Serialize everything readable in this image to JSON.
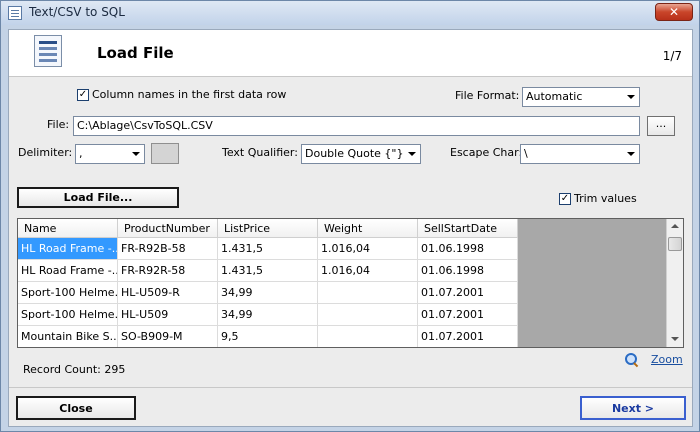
{
  "window": {
    "title": "Text/CSV to SQL",
    "close_glyph": "✕"
  },
  "header": {
    "title": "Load File",
    "step": "1/7"
  },
  "options": {
    "column_names_label": "Column names in the first data row",
    "column_names_checked": "✓",
    "file_format_label": "File Format:",
    "file_format_value": "Automatic",
    "file_label": "File:",
    "file_value": "C:\\Ablage\\CsvToSQL.CSV",
    "browse_label": "...",
    "delimiter_label": "Delimiter:",
    "delimiter_value": ",",
    "text_qualifier_label": "Text Qualifier:",
    "text_qualifier_value": "Double Quote {\"}",
    "escape_char_label": "Escape Char:",
    "escape_char_value": "\\",
    "load_file_label": "Load File...",
    "trim_values_label": "Trim values",
    "trim_values_checked": "✓"
  },
  "grid": {
    "columns": [
      "Name",
      "ProductNumber",
      "ListPrice",
      "Weight",
      "SellStartDate"
    ],
    "rows": [
      [
        "HL Road Frame -...",
        "FR-R92B-58",
        "1.431,5",
        "1.016,04",
        "01.06.1998"
      ],
      [
        "HL Road Frame -...",
        "FR-R92R-58",
        "1.431,5",
        "1.016,04",
        "01.06.1998"
      ],
      [
        "Sport-100 Helme...",
        "HL-U509-R",
        "34,99",
        "",
        "01.07.2001"
      ],
      [
        "Sport-100 Helme...",
        "HL-U509",
        "34,99",
        "",
        "01.07.2001"
      ],
      [
        "Mountain Bike S...",
        "SO-B909-M",
        "9,5",
        "",
        "01.07.2001"
      ]
    ]
  },
  "footer": {
    "zoom_label": "Zoom",
    "record_count": "Record Count: 295",
    "close_label": "Close",
    "next_label": "Next >"
  }
}
